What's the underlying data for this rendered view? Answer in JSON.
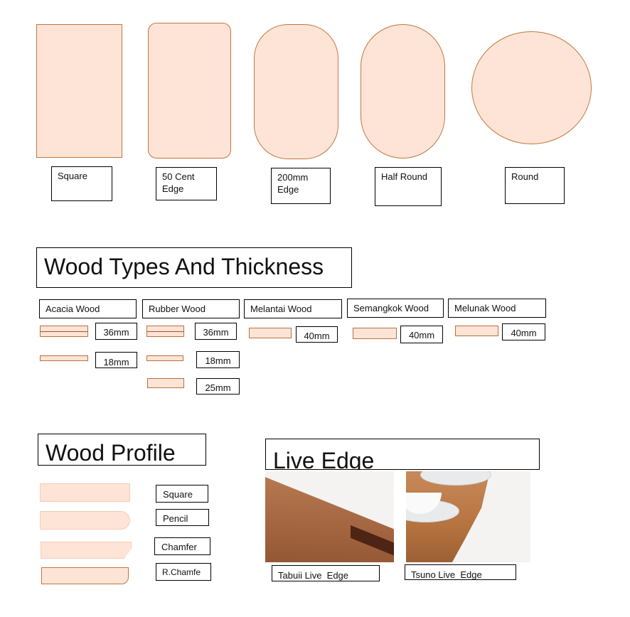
{
  "shapes": [
    {
      "label": "Square"
    },
    {
      "label": "50 Cent Edge"
    },
    {
      "label": "200mm Edge"
    },
    {
      "label": "Half Round"
    },
    {
      "label": "Round"
    }
  ],
  "wood_section": {
    "title": "Wood Types And Thickness",
    "types": [
      {
        "name": "Acacia Wood",
        "thickness": [
          "36mm",
          "18mm"
        ]
      },
      {
        "name": "Rubber Wood",
        "thickness": [
          "36mm",
          "18mm",
          "25mm"
        ]
      },
      {
        "name": "Melantai Wood",
        "thickness": [
          "40mm"
        ]
      },
      {
        "name": "Semangkok Wood",
        "thickness": [
          "40mm"
        ]
      },
      {
        "name": "Melunak Wood",
        "thickness": [
          "40mm"
        ]
      }
    ]
  },
  "profile_section": {
    "title": "Wood Profile",
    "items": [
      "Square",
      "Pencil",
      "Chamfer",
      "R.Chamfe"
    ]
  },
  "live_edge": {
    "title": "Live Edge",
    "items": [
      "Tabuii Live  Edge",
      "Tsuno Live  Edge"
    ]
  },
  "colors": {
    "fill": "#fde4d6",
    "stroke": "#c2763f"
  }
}
